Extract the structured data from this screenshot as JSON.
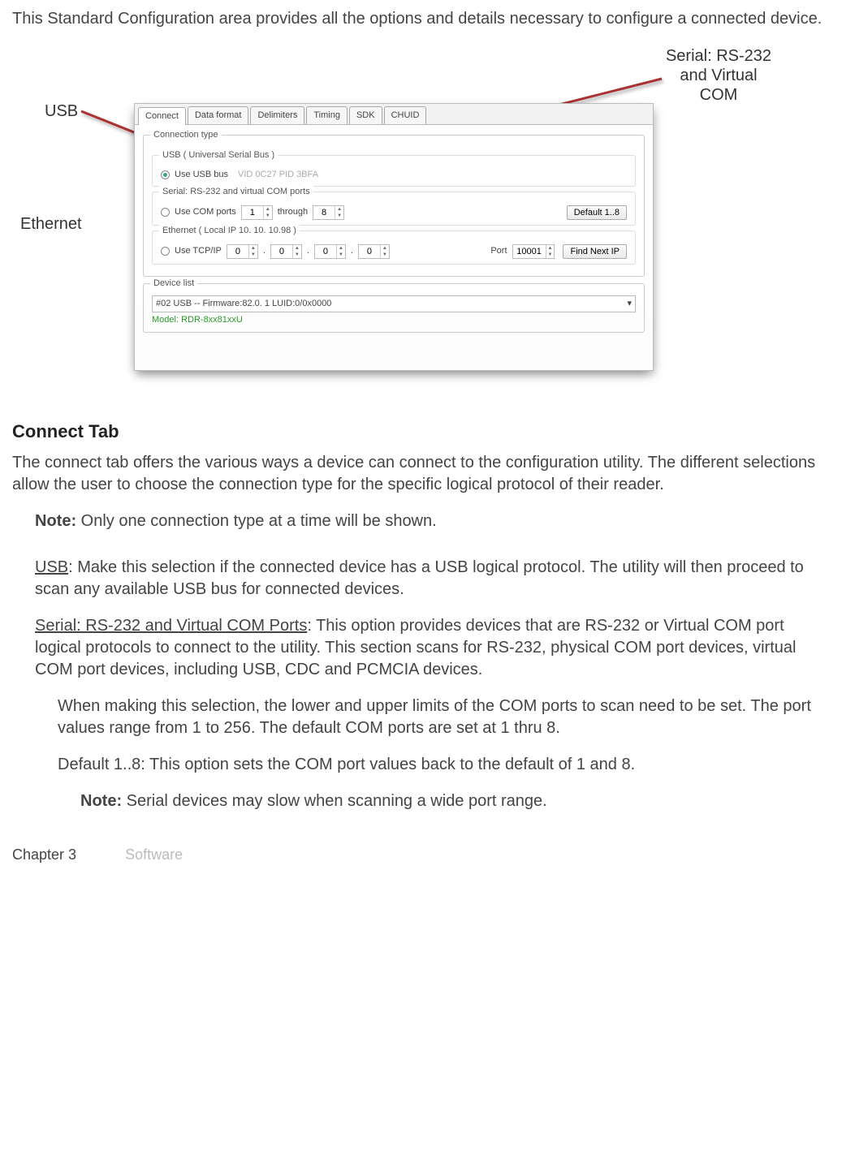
{
  "intro": "This Standard Configuration area provides all the options and details necessary to configure a connected device.",
  "callouts": {
    "usb": "USB",
    "ethernet": "Ethernet",
    "serial_l1": "Serial: RS-232",
    "serial_l2": "and Virtual",
    "serial_l3": "COM"
  },
  "screenshot": {
    "tabs": [
      "Connect",
      "Data format",
      "Delimiters",
      "Timing",
      "SDK",
      "CHUID"
    ],
    "group_title": "Connection type",
    "usb": {
      "title": "USB ( Universal Serial Bus )",
      "radio": "Use USB bus",
      "info": "VID 0C27 PID 3BFA"
    },
    "serial": {
      "title": "Serial: RS-232 and virtual COM ports",
      "radio": "Use COM ports",
      "from": "1",
      "through_label": "through",
      "to": "8",
      "default_btn": "Default 1..8"
    },
    "eth": {
      "title": "Ethernet ( Local IP 10. 10. 10.98 )",
      "radio": "Use TCP/IP",
      "ip": [
        "0",
        "0",
        "0",
        "0"
      ],
      "port_label": "Port",
      "port": "10001",
      "find_btn": "Find Next IP"
    },
    "device_list": {
      "title": "Device list",
      "selected": "#02 USB -- Firmware:82.0. 1 LUID:0/0x0000",
      "model": "Model: RDR-8xx81xxU"
    }
  },
  "section_heading": "Connect Tab",
  "para_connect": "The connect tab offers the various ways a device can connect to the configuration utility. The different selections allow the user to choose the connection type for the specific logical protocol of their reader.",
  "note1_label": "Note:",
  "note1_text": " Only one connection type at a time will be shown.",
  "usb_label": "USB",
  "usb_text": ": Make this selection if the connected device has a USB logical protocol. The utility will then proceed to scan any available USB bus for connected devices.",
  "serial_label": "Serial: RS-232 and Virtual COM Ports",
  "serial_text": ": This option provides devices that are RS-232 or Virtual COM port logical protocols to connect to the utility. This section scans for RS-232, physical COM port devices, virtual COM port devices, including USB, CDC and PCMCIA devices.",
  "serial_sub1": "When making this selection, the lower and upper limits of the COM ports to scan need to be set. The port values range from 1 to 256. The default COM ports are set at 1 thru 8.",
  "serial_sub2": "Default 1..8: This option sets the COM port values back to the default of 1 and 8.",
  "note2_label": "Note:",
  "note2_text": " Serial devices may slow when scanning a wide port range.",
  "footer_chapter": "Chapter 3",
  "footer_section": "Software"
}
